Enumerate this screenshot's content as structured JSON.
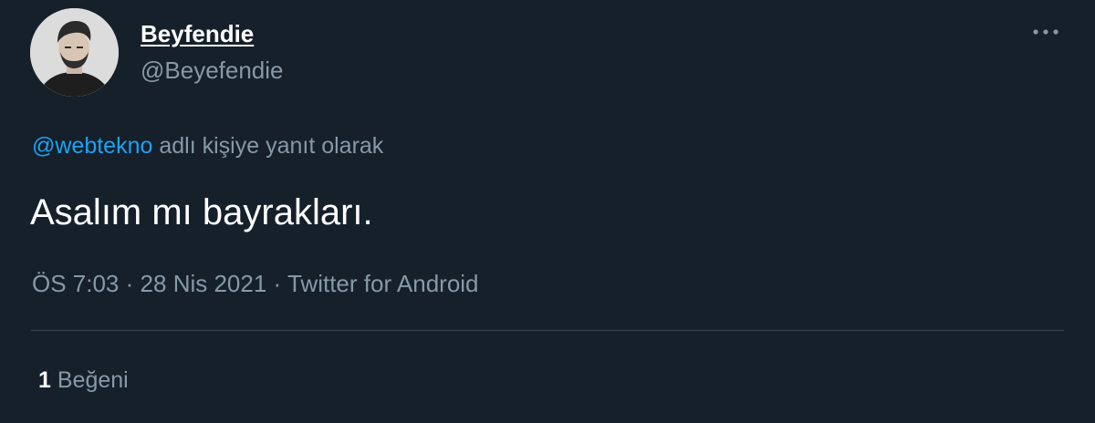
{
  "tweet": {
    "author": {
      "display_name": "Beyfendie",
      "handle": "@Beyefendie",
      "avatar_icon": "user-avatar"
    },
    "more_icon": "more-horizontal-icon",
    "reply_context": {
      "mention": "@webtekno",
      "suffix": "adlı kişiye yanıt olarak"
    },
    "text": "Asalım mı bayrakları.",
    "meta": {
      "time": "ÖS 7:03",
      "separator1": "·",
      "date": "28 Nis 2021",
      "separator2": "·",
      "source": "Twitter for Android"
    },
    "likes": {
      "count": "1",
      "label": "Beğeni"
    }
  },
  "colors": {
    "background": "#15202b",
    "primary_text": "#ffffff",
    "secondary_text": "#8899a6",
    "link": "#1da1f2",
    "divider": "#38444d"
  }
}
